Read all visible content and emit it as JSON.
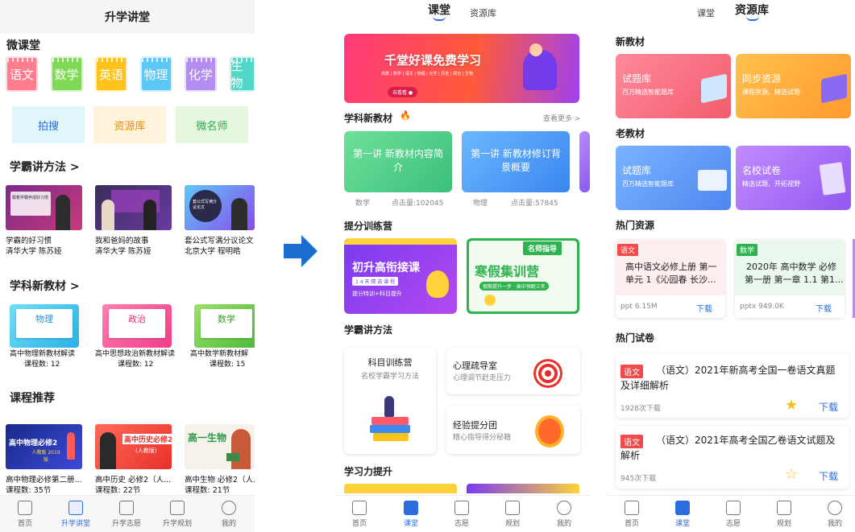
{
  "screen1": {
    "header_title": "升学讲堂",
    "section_micro": "微课堂",
    "subjects": [
      {
        "label": "语文",
        "color": "#ff7d8c"
      },
      {
        "label": "数学",
        "color": "#7ed957"
      },
      {
        "label": "英语",
        "color": "#ffc21a"
      },
      {
        "label": "物理",
        "color": "#5cc8f5"
      },
      {
        "label": "化学",
        "color": "#b48cf2"
      },
      {
        "label": "生物",
        "color": "#4fd8c8"
      }
    ],
    "tools": [
      {
        "label": "拍搜",
        "bg": "#dff6fb",
        "fg": "#2b6ddf"
      },
      {
        "label": "资源库",
        "bg": "#fff3dc",
        "fg": "#f08a00"
      },
      {
        "label": "微名师",
        "bg": "#e6f7e0",
        "fg": "#2aa84a"
      }
    ],
    "section_method": "学霸讲方法 >",
    "method_videos": [
      {
        "line1": "学霸的好习惯",
        "line2": "清华大学 陈苏娅",
        "thumb_text": "跟着学霸养成好习惯"
      },
      {
        "line1": "我和爸妈的故事",
        "line2": "清华大学 陈苏娅",
        "thumb_text": ""
      },
      {
        "line1": "套公式写满分议论文",
        "line2": "北京大学 程明皓",
        "thumb_text": "套公式写满分议论文"
      }
    ],
    "section_textbook": "学科新教材 >",
    "textbooks": [
      {
        "subject": "物理",
        "title": "高中物理新教材解读",
        "count": "课程数:  12"
      },
      {
        "subject": "政治",
        "title": "高中思想政治新教材解读",
        "count": "课程数:  12"
      },
      {
        "subject": "数学",
        "title": "高中数学新教材解",
        "count": "课程数:  15"
      }
    ],
    "section_recommend": "课程推荐",
    "recommend": [
      {
        "thumb": "高中物理必修2",
        "thumb2": "人教版 2019版",
        "title": "高中物理必修第二册...",
        "count": "课程数: 35节"
      },
      {
        "thumb": "高中历史必修2",
        "thumb2": "(人教版)",
        "title": "高中历史 必修2（人...",
        "count": "课程数: 22节"
      },
      {
        "thumb": "高一生物",
        "thumb2": "",
        "title": "高中生物 必修2（人...",
        "count": "课程数: 21节"
      }
    ],
    "nav": [
      "首页",
      "升学讲堂",
      "升学志愿",
      "升学规划",
      "我的"
    ]
  },
  "screen2": {
    "tabs": [
      "课堂",
      "资源库"
    ],
    "banner_title": "千堂好课免费学习",
    "banner_subjects": "高数 | 数学 | 语文 | 物理 | 化学 | 历史 | 政治 | 生物",
    "banner_button": "去看看 ●",
    "section_textbook": "学科新教材",
    "more": "查看更多 >",
    "textbook_cards": [
      {
        "title": "第一讲 新教材内容简介",
        "subject": "数学",
        "clicks": "点击量:102045",
        "color": "#5fd18a"
      },
      {
        "title": "第一讲 新教材修订背景概要",
        "subject": "物理",
        "clicks": "点击量:57845",
        "color": "#4fa0f5"
      }
    ],
    "section_camp": "提分训练营",
    "camp_left_title": "初升高衔接课",
    "camp_left_sub": "1 4 天 精 选 课 程",
    "camp_left_foot": "提分特训+科目提升",
    "camp_right_badge": "名师指导",
    "camp_right_title": "寒假集训营",
    "camp_right_sub": "假期提升一步 · 高中领跑三年",
    "section_method": "学霸讲方法",
    "method_big_title": "科目训练营",
    "method_big_sub": "名校学霸学习方法",
    "method_items": [
      {
        "title": "心理疏导室",
        "sub": "心理调节赶走压力"
      },
      {
        "title": "经验提分团",
        "sub": "精心指导得分秘籍"
      }
    ],
    "section_ability": "学习力提升",
    "nav": [
      "首页",
      "课堂",
      "志愿",
      "规划",
      "我的"
    ]
  },
  "screen3": {
    "tabs": [
      "课堂",
      "资源库"
    ],
    "section_new": "新教材",
    "new_cards": [
      {
        "title": "试题库",
        "sub": "百万精选智能题库",
        "color1": "#ff8a9a",
        "color2": "#f25c6e"
      },
      {
        "title": "同步资源",
        "sub": "课程资源、精选试题",
        "color1": "#ffc14d",
        "color2": "#ff9a2e"
      }
    ],
    "section_old": "老教材",
    "old_cards": [
      {
        "title": "试题库",
        "sub": "百万精选智能题库",
        "color1": "#7ab4ff",
        "color2": "#4f86f0"
      },
      {
        "title": "名校试卷",
        "sub": "精选试题、开拓视野",
        "color1": "#c18cff",
        "color2": "#9257f0"
      }
    ],
    "section_hot_res": "热门资源",
    "hot_res": [
      {
        "tag": "语文",
        "tag_color": "#f24b4b",
        "title1": "高中语文必修上册 第一",
        "title2": "单元 1《沁园春 长沙...",
        "meta": "ppt  6.15M",
        "action": "下载",
        "bg": "#fdeef0"
      },
      {
        "tag": "数学",
        "tag_color": "#2fb34f",
        "title1": "2020年 高中数学 必修",
        "title2": "第一册 第一章 1.1 第1...",
        "meta": "pptx  949.0K",
        "action": "下载",
        "bg": "#eaf8ee"
      }
    ],
    "section_hot_paper": "热门试卷",
    "papers": [
      {
        "tag": "语文",
        "title1": "（语文）2021年新高考全国一卷语文真题",
        "title2": "及详细解析",
        "meta": "1928次下载",
        "action": "下载",
        "starred": true
      },
      {
        "tag": "语文",
        "title1": "（语文）2021年高考全国乙卷语文试题及",
        "title2": "解析",
        "meta": "945次下载",
        "action": "下载",
        "starred": false
      }
    ],
    "nav": [
      "首页",
      "课堂",
      "志愿",
      "规划",
      "我的"
    ]
  }
}
